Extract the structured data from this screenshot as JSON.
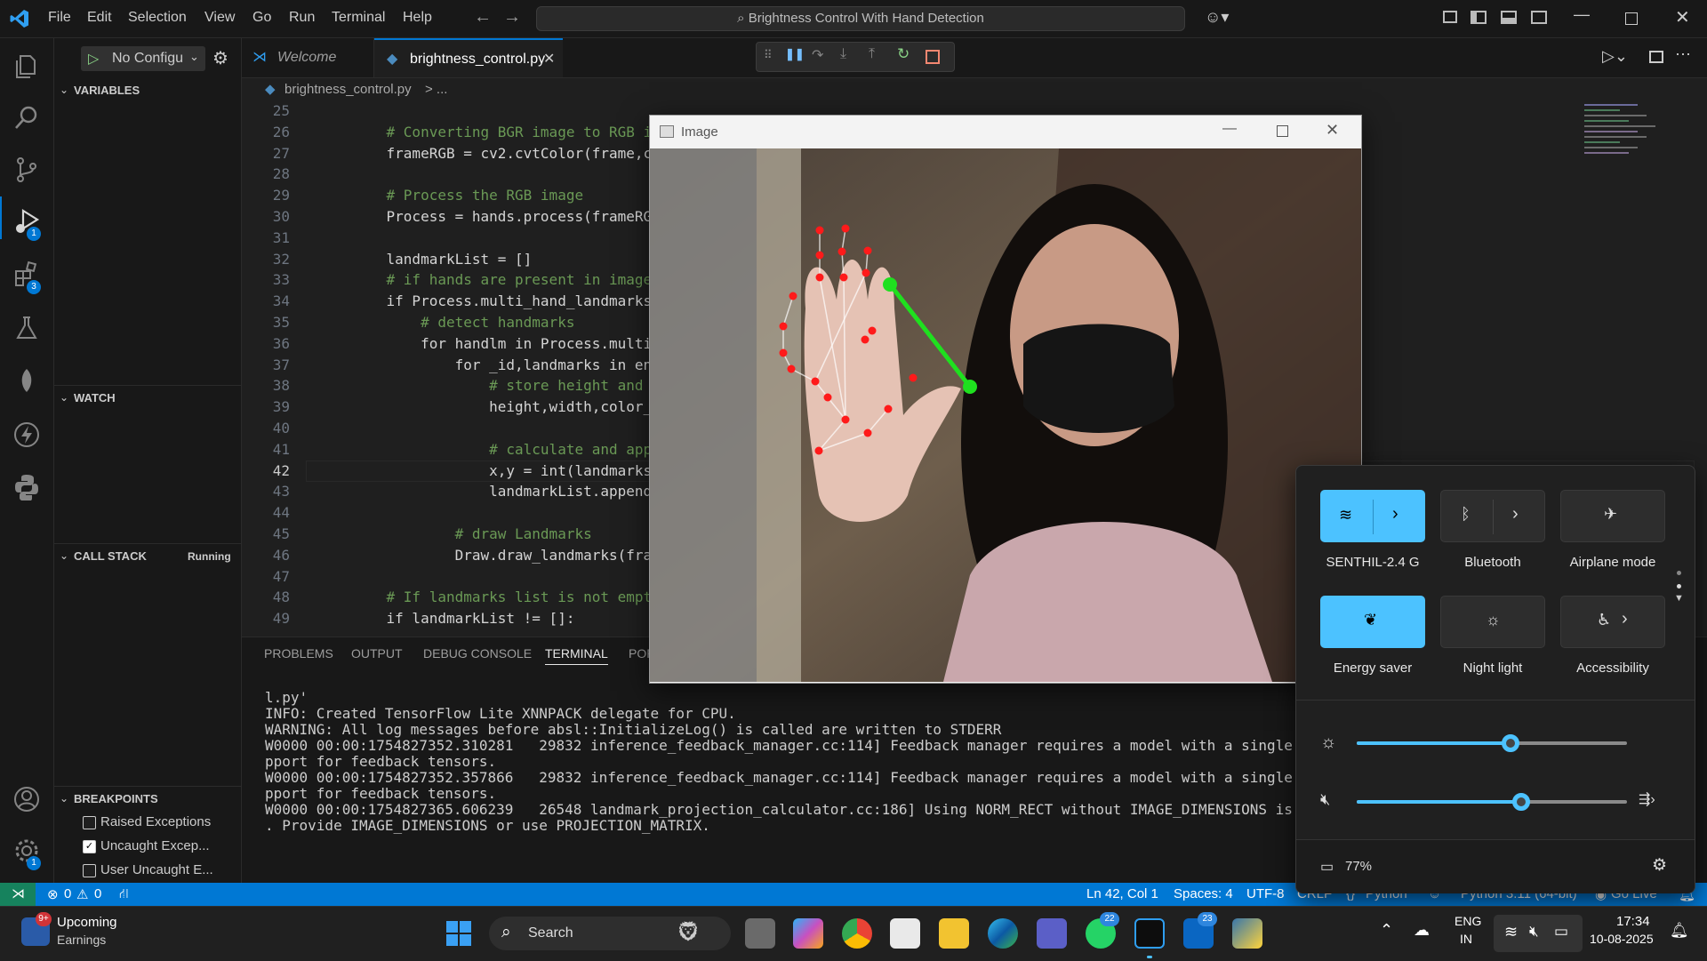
{
  "menu": [
    "File",
    "Edit",
    "Selection",
    "View",
    "Go",
    "Run",
    "Terminal",
    "Help"
  ],
  "command_center": "Brightness Control With Hand Detection",
  "activity": {
    "run_badge": "1",
    "ext_badge": "3",
    "settings_badge": "1"
  },
  "sidebar": {
    "run_config": "No Configu",
    "variables": "VARIABLES",
    "watch": "WATCH",
    "call_stack": "CALL STACK",
    "call_stack_status": "Running",
    "breakpoints": "BREAKPOINTS",
    "bp_items": [
      {
        "label": "Raised Exceptions",
        "checked": false
      },
      {
        "label": "Uncaught Excep...",
        "checked": true
      },
      {
        "label": "User Uncaught E...",
        "checked": false
      }
    ]
  },
  "tabs": [
    {
      "label": "Welcome"
    },
    {
      "label": "brightness_control.py"
    }
  ],
  "breadcrumb": {
    "file": "brightness_control.py",
    "rest": "> ..."
  },
  "code_lines": [
    {
      "n": "25",
      "t": ""
    },
    {
      "n": "26",
      "t": "    # Converting BGR image to RGB image"
    },
    {
      "n": "27",
      "t": "    frameRGB = cv2.cvtColor(frame,cv2.C"
    },
    {
      "n": "28",
      "t": ""
    },
    {
      "n": "29",
      "t": "    # Process the RGB image"
    },
    {
      "n": "30",
      "t": "    Process = hands.process(frameRGB)"
    },
    {
      "n": "31",
      "t": ""
    },
    {
      "n": "32",
      "t": "    landmarkList = []"
    },
    {
      "n": "33",
      "t": "    # if hands are present in image(fra"
    },
    {
      "n": "34",
      "t": "    if Process.multi_hand_landmarks:"
    },
    {
      "n": "35",
      "t": "        # detect handmarks"
    },
    {
      "n": "36",
      "t": "        for handlm in Process.multi_han"
    },
    {
      "n": "37",
      "t": "            for _id,landmarks in enumer"
    },
    {
      "n": "38",
      "t": "                # store height and widt"
    },
    {
      "n": "39",
      "t": "                height,width,color_chan"
    },
    {
      "n": "40",
      "t": ""
    },
    {
      "n": "41",
      "t": "                # calculate and append"
    },
    {
      "n": "42",
      "t": "                x,y = int(landmarks.x*w"
    },
    {
      "n": "43",
      "t": "                landmarkList.append([_i"
    },
    {
      "n": "44",
      "t": ""
    },
    {
      "n": "45",
      "t": "            # draw Landmarks"
    },
    {
      "n": "46",
      "t": "            Draw.draw_landmarks(frame,h"
    },
    {
      "n": "47",
      "t": ""
    },
    {
      "n": "48",
      "t": "    # If landmarks list is not empty"
    },
    {
      "n": "49",
      "t": "    if landmarkList != []:"
    }
  ],
  "panel_tabs": [
    "PROBLEMS",
    "OUTPUT",
    "DEBUG CONSOLE",
    "TERMINAL",
    "POR"
  ],
  "terminal_lines": [
    "l.py'",
    "INFO: Created TensorFlow Lite XNNPACK delegate for CPU.",
    "WARNING: All log messages before absl::InitializeLog() is called are written to STDERR",
    "W0000 00:00:1754827352.310281   29832 inference_feedback_manager.cc:114] Feedback manager requires a model with a single signatur",
    "pport for feedback tensors.",
    "W0000 00:00:1754827352.357866   29832 inference_feedback_manager.cc:114] Feedback manager requires a model with a single signatur",
    "pport for feedback tensors.",
    "W0000 00:00:1754827365.606239   26548 landmark_projection_calculator.cc:186] Using NORM_RECT without IMAGE_DIMENSIONS is only sup",
    ". Provide IMAGE_DIMENSIONS or use PROJECTION_MATRIX."
  ],
  "status": {
    "errors": "0",
    "warnings": "0",
    "position": "Ln 42, Col 1",
    "spaces": "Spaces: 4",
    "encoding": "UTF-8",
    "eol": "CRLF",
    "language": "Python",
    "interpreter": "Python 3.11 (64-bit)",
    "golive": "Go Live"
  },
  "image_window": {
    "title": "Image"
  },
  "quick_settings": {
    "tiles": [
      {
        "label": "SENTHIL-2.4 G",
        "on": true
      },
      {
        "label": "Bluetooth",
        "on": false
      },
      {
        "label": "Airplane mode",
        "on": false
      },
      {
        "label": "Energy saver",
        "on": true
      },
      {
        "label": "Night light",
        "on": false
      },
      {
        "label": "Accessibility",
        "on": false
      }
    ],
    "brightness": 0.57,
    "volume": 0.61,
    "battery": "77%"
  },
  "taskbar": {
    "weather_title": "Upcoming",
    "weather_sub": "Earnings",
    "weather_badge": "9+",
    "search": "Search",
    "whatsapp_badge": "22",
    "linkedin_badge": "23",
    "lang1": "ENG",
    "lang2": "IN",
    "time": "17:34",
    "date": "10-08-2025"
  },
  "colors": {
    "accent": "#0078d4",
    "toggle_on": "#4cc2ff",
    "landmark": "#ff1a1a",
    "line": "#1fe01f"
  }
}
